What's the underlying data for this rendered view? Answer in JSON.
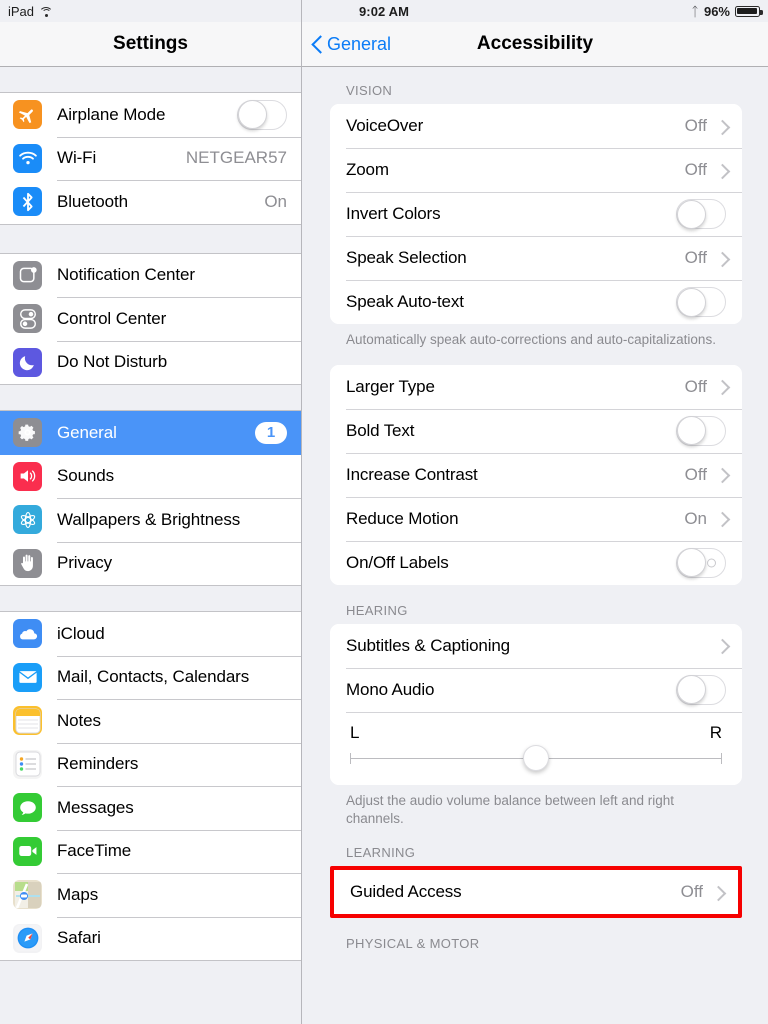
{
  "status_bar": {
    "device": "iPad",
    "wifi_icon": "wifi-icon",
    "time": "9:02 AM",
    "bluetooth_icon": "bluetooth-icon",
    "battery_percent": "96%"
  },
  "sidebar": {
    "title": "Settings",
    "groups": [
      {
        "items": [
          {
            "label": "Airplane Mode",
            "icon": "airplane-icon",
            "icon_bg": "#f79220",
            "accessory": "toggle",
            "toggle_on": false
          },
          {
            "label": "Wi-Fi",
            "icon": "wifi-icon",
            "icon_bg": "#1a8cf8",
            "accessory": "value",
            "value": "NETGEAR57"
          },
          {
            "label": "Bluetooth",
            "icon": "bluetooth-icon",
            "icon_bg": "#1a8cf8",
            "accessory": "value",
            "value": "On"
          }
        ]
      },
      {
        "items": [
          {
            "label": "Notification Center",
            "icon": "notification-center-icon",
            "icon_bg": "#8e8e93",
            "accessory": "none"
          },
          {
            "label": "Control Center",
            "icon": "control-center-icon",
            "icon_bg": "#8e8e93",
            "accessory": "none"
          },
          {
            "label": "Do Not Disturb",
            "icon": "moon-icon",
            "icon_bg": "#5d58e0",
            "accessory": "none"
          }
        ]
      },
      {
        "items": [
          {
            "label": "General",
            "icon": "gear-icon",
            "icon_bg": "#8e8e93",
            "accessory": "badge",
            "badge": "1",
            "selected": true
          },
          {
            "label": "Sounds",
            "icon": "speaker-icon",
            "icon_bg": "#fa2e4e",
            "accessory": "none"
          },
          {
            "label": "Wallpapers & Brightness",
            "icon": "flower-icon",
            "icon_bg": "#34aadc",
            "accessory": "none"
          },
          {
            "label": "Privacy",
            "icon": "hand-icon",
            "icon_bg": "#8e8e93",
            "accessory": "none"
          }
        ]
      },
      {
        "items": [
          {
            "label": "iCloud",
            "icon": "icloud-icon",
            "icon_bg": "#3f8df4",
            "accessory": "none"
          },
          {
            "label": "Mail, Contacts, Calendars",
            "icon": "mail-icon",
            "icon_bg": "#1a9ef8",
            "accessory": "none"
          },
          {
            "label": "Notes",
            "icon": "notes-icon",
            "icon_bg": "#fbc02d",
            "accessory": "none"
          },
          {
            "label": "Reminders",
            "icon": "reminders-icon",
            "icon_bg": "#f4f4f4",
            "accessory": "none"
          },
          {
            "label": "Messages",
            "icon": "messages-icon",
            "icon_bg": "#34cb35",
            "accessory": "none"
          },
          {
            "label": "FaceTime",
            "icon": "facetime-icon",
            "icon_bg": "#34cb35",
            "accessory": "none"
          },
          {
            "label": "Maps",
            "icon": "maps-icon",
            "icon_bg": "#e8e0cc",
            "accessory": "none"
          },
          {
            "label": "Safari",
            "icon": "safari-icon",
            "icon_bg": "#f2f2f4",
            "accessory": "none"
          }
        ]
      }
    ]
  },
  "detail": {
    "back_label": "General",
    "title": "Accessibility",
    "sections": [
      {
        "header": "VISION",
        "rows": [
          {
            "label": "VoiceOver",
            "accessory": "disclosure",
            "value": "Off"
          },
          {
            "label": "Zoom",
            "accessory": "disclosure",
            "value": "Off"
          },
          {
            "label": "Invert Colors",
            "accessory": "toggle",
            "toggle_on": false
          },
          {
            "label": "Speak Selection",
            "accessory": "disclosure",
            "value": "Off"
          },
          {
            "label": "Speak Auto-text",
            "accessory": "toggle",
            "toggle_on": false
          }
        ],
        "footnote": "Automatically speak auto-corrections and auto-capitalizations."
      },
      {
        "header": "",
        "rows": [
          {
            "label": "Larger Type",
            "accessory": "disclosure",
            "value": "Off"
          },
          {
            "label": "Bold Text",
            "accessory": "toggle",
            "toggle_on": false
          },
          {
            "label": "Increase Contrast",
            "accessory": "disclosure",
            "value": "Off"
          },
          {
            "label": "Reduce Motion",
            "accessory": "disclosure",
            "value": "On"
          },
          {
            "label": "On/Off Labels",
            "accessory": "toggle-labeled",
            "toggle_on": false
          }
        ],
        "footnote": ""
      },
      {
        "header": "HEARING",
        "rows": [
          {
            "label": "Subtitles & Captioning",
            "accessory": "disclosure",
            "value": ""
          },
          {
            "label": "Mono Audio",
            "accessory": "toggle",
            "toggle_on": false
          }
        ],
        "slider": {
          "left_label": "L",
          "right_label": "R",
          "value_percent": 50
        },
        "footnote": "Adjust the audio volume balance between left and right channels."
      },
      {
        "header": "LEARNING",
        "highlighted": true,
        "rows": [
          {
            "label": "Guided Access",
            "accessory": "disclosure",
            "value": "Off"
          }
        ],
        "footnote": ""
      },
      {
        "header": "PHYSICAL & MOTOR",
        "rows": [],
        "footnote": ""
      }
    ]
  },
  "colors": {
    "accent_blue": "#0b7cf7",
    "selected_row": "#4a94f8",
    "highlight_red": "#f60000",
    "panel_bg": "#eff0f4",
    "value_gray": "#8e8e93"
  }
}
